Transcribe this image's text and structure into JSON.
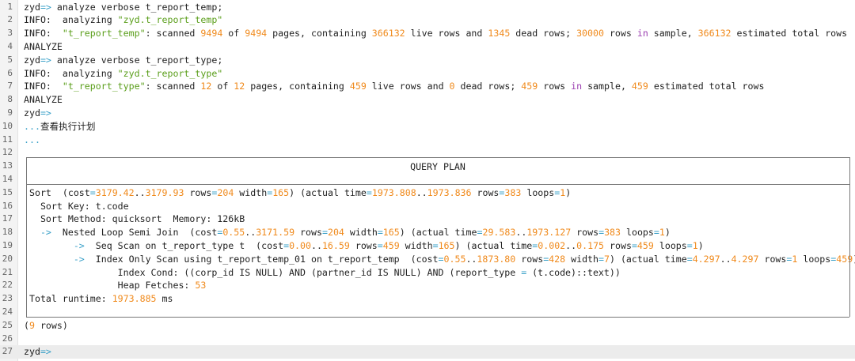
{
  "terminal": {
    "lines": [
      {
        "n": "1",
        "tokens": [
          {
            "t": "zyd",
            "c": "plain"
          },
          {
            "t": "=>",
            "c": "op"
          },
          {
            "t": " analyze verbose t_report_temp;",
            "c": "plain"
          }
        ]
      },
      {
        "n": "2",
        "tokens": [
          {
            "t": "INFO:  analyzing ",
            "c": "plain"
          },
          {
            "t": "\"zyd.t_report_temp\"",
            "c": "str"
          }
        ]
      },
      {
        "n": "3",
        "tokens": [
          {
            "t": "INFO:  ",
            "c": "plain"
          },
          {
            "t": "\"t_report_temp\"",
            "c": "str"
          },
          {
            "t": ": scanned ",
            "c": "plain"
          },
          {
            "t": "9494",
            "c": "num"
          },
          {
            "t": " of ",
            "c": "plain"
          },
          {
            "t": "9494",
            "c": "num"
          },
          {
            "t": " pages, containing ",
            "c": "plain"
          },
          {
            "t": "366132",
            "c": "num"
          },
          {
            "t": " live rows and ",
            "c": "plain"
          },
          {
            "t": "1345",
            "c": "num"
          },
          {
            "t": " dead rows; ",
            "c": "plain"
          },
          {
            "t": "30000",
            "c": "num"
          },
          {
            "t": " rows ",
            "c": "plain"
          },
          {
            "t": "in",
            "c": "kw"
          },
          {
            "t": " sample, ",
            "c": "plain"
          },
          {
            "t": "366132",
            "c": "num"
          },
          {
            "t": " estimated total rows",
            "c": "plain"
          }
        ]
      },
      {
        "n": "4",
        "tokens": [
          {
            "t": "ANALYZE",
            "c": "plain"
          }
        ]
      },
      {
        "n": "5",
        "tokens": [
          {
            "t": "zyd",
            "c": "plain"
          },
          {
            "t": "=>",
            "c": "op"
          },
          {
            "t": " analyze verbose t_report_type;",
            "c": "plain"
          }
        ]
      },
      {
        "n": "6",
        "tokens": [
          {
            "t": "INFO:  analyzing ",
            "c": "plain"
          },
          {
            "t": "\"zyd.t_report_type\"",
            "c": "str"
          }
        ]
      },
      {
        "n": "7",
        "tokens": [
          {
            "t": "INFO:  ",
            "c": "plain"
          },
          {
            "t": "\"t_report_type\"",
            "c": "str"
          },
          {
            "t": ": scanned ",
            "c": "plain"
          },
          {
            "t": "12",
            "c": "num"
          },
          {
            "t": " of ",
            "c": "plain"
          },
          {
            "t": "12",
            "c": "num"
          },
          {
            "t": " pages, containing ",
            "c": "plain"
          },
          {
            "t": "459",
            "c": "num"
          },
          {
            "t": " live rows and ",
            "c": "plain"
          },
          {
            "t": "0",
            "c": "num"
          },
          {
            "t": " dead rows; ",
            "c": "plain"
          },
          {
            "t": "459",
            "c": "num"
          },
          {
            "t": " rows ",
            "c": "plain"
          },
          {
            "t": "in",
            "c": "kw"
          },
          {
            "t": " sample, ",
            "c": "plain"
          },
          {
            "t": "459",
            "c": "num"
          },
          {
            "t": " estimated total rows",
            "c": "plain"
          }
        ]
      },
      {
        "n": "8",
        "tokens": [
          {
            "t": "ANALYZE",
            "c": "plain"
          }
        ]
      },
      {
        "n": "9",
        "tokens": [
          {
            "t": "zyd",
            "c": "plain"
          },
          {
            "t": "=>",
            "c": "op"
          }
        ]
      },
      {
        "n": "10",
        "tokens": [
          {
            "t": "...",
            "c": "op"
          },
          {
            "t": "查看执行计划",
            "c": "plain"
          }
        ]
      },
      {
        "n": "11",
        "tokens": [
          {
            "t": "...",
            "c": "op"
          }
        ]
      },
      {
        "n": "12",
        "tokens": []
      },
      {
        "n": "13",
        "tokens": []
      },
      {
        "n": "14",
        "tokens": []
      },
      {
        "n": "15",
        "tokens": [
          {
            "t": " Sort  (cost",
            "c": "plain"
          },
          {
            "t": "=",
            "c": "op"
          },
          {
            "t": "3179.42",
            "c": "num"
          },
          {
            "t": "..",
            "c": "plain"
          },
          {
            "t": "3179.93",
            "c": "num"
          },
          {
            "t": " rows",
            "c": "plain"
          },
          {
            "t": "=",
            "c": "op"
          },
          {
            "t": "204",
            "c": "num"
          },
          {
            "t": " width",
            "c": "plain"
          },
          {
            "t": "=",
            "c": "op"
          },
          {
            "t": "165",
            "c": "num"
          },
          {
            "t": ") (actual time",
            "c": "plain"
          },
          {
            "t": "=",
            "c": "op"
          },
          {
            "t": "1973.808",
            "c": "num"
          },
          {
            "t": "..",
            "c": "plain"
          },
          {
            "t": "1973.836",
            "c": "num"
          },
          {
            "t": " rows",
            "c": "plain"
          },
          {
            "t": "=",
            "c": "op"
          },
          {
            "t": "383",
            "c": "num"
          },
          {
            "t": " loops",
            "c": "plain"
          },
          {
            "t": "=",
            "c": "op"
          },
          {
            "t": "1",
            "c": "num"
          },
          {
            "t": ")",
            "c": "plain"
          }
        ]
      },
      {
        "n": "16",
        "tokens": [
          {
            "t": "   Sort Key: t.code",
            "c": "plain"
          }
        ]
      },
      {
        "n": "17",
        "tokens": [
          {
            "t": "   Sort Method: quicksort  Memory: 126kB",
            "c": "plain"
          }
        ]
      },
      {
        "n": "18",
        "tokens": [
          {
            "t": "   ",
            "c": "plain"
          },
          {
            "t": "->",
            "c": "op"
          },
          {
            "t": "  Nested Loop Semi Join  (cost",
            "c": "plain"
          },
          {
            "t": "=",
            "c": "op"
          },
          {
            "t": "0.55",
            "c": "num"
          },
          {
            "t": "..",
            "c": "plain"
          },
          {
            "t": "3171.59",
            "c": "num"
          },
          {
            "t": " rows",
            "c": "plain"
          },
          {
            "t": "=",
            "c": "op"
          },
          {
            "t": "204",
            "c": "num"
          },
          {
            "t": " width",
            "c": "plain"
          },
          {
            "t": "=",
            "c": "op"
          },
          {
            "t": "165",
            "c": "num"
          },
          {
            "t": ") (actual time",
            "c": "plain"
          },
          {
            "t": "=",
            "c": "op"
          },
          {
            "t": "29.583",
            "c": "num"
          },
          {
            "t": "..",
            "c": "plain"
          },
          {
            "t": "1973.127",
            "c": "num"
          },
          {
            "t": " rows",
            "c": "plain"
          },
          {
            "t": "=",
            "c": "op"
          },
          {
            "t": "383",
            "c": "num"
          },
          {
            "t": " loops",
            "c": "plain"
          },
          {
            "t": "=",
            "c": "op"
          },
          {
            "t": "1",
            "c": "num"
          },
          {
            "t": ")",
            "c": "plain"
          }
        ]
      },
      {
        "n": "19",
        "tokens": [
          {
            "t": "         ",
            "c": "plain"
          },
          {
            "t": "->",
            "c": "op"
          },
          {
            "t": "  Seq Scan on t_report_type t  (cost",
            "c": "plain"
          },
          {
            "t": "=",
            "c": "op"
          },
          {
            "t": "0.00",
            "c": "num"
          },
          {
            "t": "..",
            "c": "plain"
          },
          {
            "t": "16.59",
            "c": "num"
          },
          {
            "t": " rows",
            "c": "plain"
          },
          {
            "t": "=",
            "c": "op"
          },
          {
            "t": "459",
            "c": "num"
          },
          {
            "t": " width",
            "c": "plain"
          },
          {
            "t": "=",
            "c": "op"
          },
          {
            "t": "165",
            "c": "num"
          },
          {
            "t": ") (actual time",
            "c": "plain"
          },
          {
            "t": "=",
            "c": "op"
          },
          {
            "t": "0.002",
            "c": "num"
          },
          {
            "t": "..",
            "c": "plain"
          },
          {
            "t": "0.175",
            "c": "num"
          },
          {
            "t": " rows",
            "c": "plain"
          },
          {
            "t": "=",
            "c": "op"
          },
          {
            "t": "459",
            "c": "num"
          },
          {
            "t": " loops",
            "c": "plain"
          },
          {
            "t": "=",
            "c": "op"
          },
          {
            "t": "1",
            "c": "num"
          },
          {
            "t": ")",
            "c": "plain"
          }
        ]
      },
      {
        "n": "20",
        "tokens": [
          {
            "t": "         ",
            "c": "plain"
          },
          {
            "t": "->",
            "c": "op"
          },
          {
            "t": "  Index Only Scan using t_report_temp_01 on t_report_temp  (cost",
            "c": "plain"
          },
          {
            "t": "=",
            "c": "op"
          },
          {
            "t": "0.55",
            "c": "num"
          },
          {
            "t": "..",
            "c": "plain"
          },
          {
            "t": "1873.80",
            "c": "num"
          },
          {
            "t": " rows",
            "c": "plain"
          },
          {
            "t": "=",
            "c": "op"
          },
          {
            "t": "428",
            "c": "num"
          },
          {
            "t": " width",
            "c": "plain"
          },
          {
            "t": "=",
            "c": "op"
          },
          {
            "t": "7",
            "c": "num"
          },
          {
            "t": ") (actual time",
            "c": "plain"
          },
          {
            "t": "=",
            "c": "op"
          },
          {
            "t": "4.297",
            "c": "num"
          },
          {
            "t": "..",
            "c": "plain"
          },
          {
            "t": "4.297",
            "c": "num"
          },
          {
            "t": " rows",
            "c": "plain"
          },
          {
            "t": "=",
            "c": "op"
          },
          {
            "t": "1",
            "c": "num"
          },
          {
            "t": " loops",
            "c": "plain"
          },
          {
            "t": "=",
            "c": "op"
          },
          {
            "t": "459",
            "c": "num"
          },
          {
            "t": ")",
            "c": "plain"
          }
        ]
      },
      {
        "n": "21",
        "tokens": [
          {
            "t": "                 Index Cond: ((corp_id IS NULL) AND (partner_id IS NULL) AND (report_type ",
            "c": "plain"
          },
          {
            "t": "=",
            "c": "op"
          },
          {
            "t": " (t.code)::text))",
            "c": "plain"
          }
        ]
      },
      {
        "n": "22",
        "tokens": [
          {
            "t": "                 Heap Fetches: ",
            "c": "plain"
          },
          {
            "t": "53",
            "c": "num"
          }
        ]
      },
      {
        "n": "23",
        "tokens": [
          {
            "t": " Total runtime: ",
            "c": "plain"
          },
          {
            "t": "1973.885",
            "c": "num"
          },
          {
            "t": " ms",
            "c": "plain"
          }
        ]
      },
      {
        "n": "24",
        "tokens": []
      },
      {
        "n": "25",
        "tokens": [
          {
            "t": "(",
            "c": "plain"
          },
          {
            "t": "9",
            "c": "num"
          },
          {
            "t": " rows)",
            "c": "plain"
          }
        ]
      },
      {
        "n": "26",
        "tokens": []
      },
      {
        "n": "27",
        "tokens": [
          {
            "t": "zyd",
            "c": "plain"
          },
          {
            "t": "=>",
            "c": "op"
          }
        ]
      }
    ],
    "plan_header": "QUERY PLAN",
    "colors": {
      "number": "#f08a1c",
      "string": "#5a9e1a",
      "keyword": "#9b3fb0",
      "operator": "#3aa0c8",
      "text": "#222222",
      "current_line": "#ececec"
    }
  }
}
